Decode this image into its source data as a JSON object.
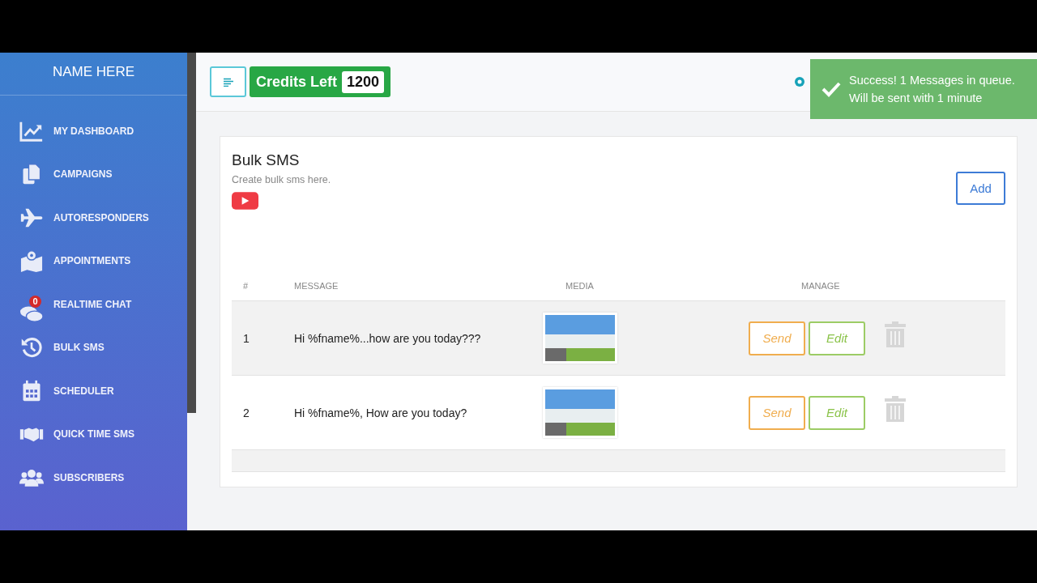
{
  "sidebar": {
    "title": "NAME HERE",
    "items": [
      {
        "label": "MY DASHBOARD"
      },
      {
        "label": "CAMPAIGNS"
      },
      {
        "label": "AUTORESPONDERS"
      },
      {
        "label": "APPOINTMENTS"
      },
      {
        "label": "REALTIME CHAT",
        "badge": "0"
      },
      {
        "label": "BULK SMS"
      },
      {
        "label": "SCHEDULER"
      },
      {
        "label": "QUICK TIME SMS"
      },
      {
        "label": "SUBSCRIBERS"
      }
    ]
  },
  "header": {
    "credits_label": "Credits Left",
    "credits_value": "1200"
  },
  "toast": {
    "line1": "Success! 1 Messages in queue.",
    "line2": "Will be sent with 1 minute"
  },
  "card": {
    "title": "Bulk SMS",
    "subtitle": "Create bulk sms here.",
    "add_button": "Add"
  },
  "table": {
    "columns": [
      "#",
      "MESSAGE",
      "MEDIA",
      "MANAGE"
    ],
    "rows": [
      {
        "number": "1",
        "message": "Hi %fname%...how are you today???",
        "send": "Send",
        "edit": "Edit"
      },
      {
        "number": "2",
        "message": "Hi %fname%, How are you today?",
        "send": "Send",
        "edit": "Edit"
      }
    ]
  }
}
